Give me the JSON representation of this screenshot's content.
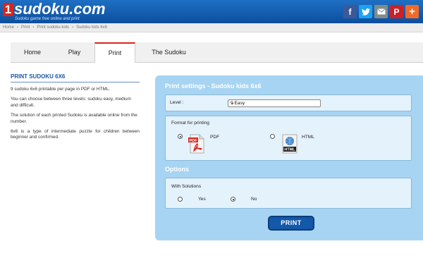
{
  "header": {
    "logo_number": "1",
    "logo_text": "sudoku.com",
    "tagline": "Sudoku game free online and print",
    "social": [
      {
        "icon": "facebook-icon",
        "glyph": "f",
        "color": "#3b5998"
      },
      {
        "icon": "twitter-icon",
        "glyph": "t",
        "color": "#1da1f2"
      },
      {
        "icon": "mail-icon",
        "glyph": "✉",
        "color": "#7f8c8d"
      },
      {
        "icon": "pinterest-icon",
        "glyph": "P",
        "color": "#cb2027"
      },
      {
        "icon": "plus-icon",
        "glyph": "+",
        "color": "#f06b2a"
      }
    ]
  },
  "breadcrumb": [
    "Home",
    "Print",
    "Print sudoku kids",
    "Sudoku kids 6x6"
  ],
  "tabs": [
    {
      "label": "Home",
      "active": false
    },
    {
      "label": "Play",
      "active": false
    },
    {
      "label": "Print",
      "active": true
    },
    {
      "label": "The Sudoku",
      "active": false
    }
  ],
  "left": {
    "title": "PRINT SUDOKU 6X6",
    "p1": "9 sudoku 6x6 printable per page in PDF or HTML.",
    "p2": "You can choose between three levels: sudoku easy, medium and difficult.",
    "p3": "The solution of each printed Sudoku is available online from the number.",
    "p4": "6x6 is a type of intermediate puzzle for children between beginner and confirmed."
  },
  "settings": {
    "title": "Print settings - Sudoku kids 6x6",
    "level_label": "Level :",
    "level_value": "9 Easy",
    "format_label": "Format for printing",
    "format_pdf": "PDF",
    "format_html": "HTML",
    "format_selected": "PDF",
    "options_title": "Options",
    "solutions_label": "With Solutions",
    "yes_label": "Yes",
    "no_label": "No",
    "solutions_selected": "No",
    "print_label": "PRINT"
  }
}
